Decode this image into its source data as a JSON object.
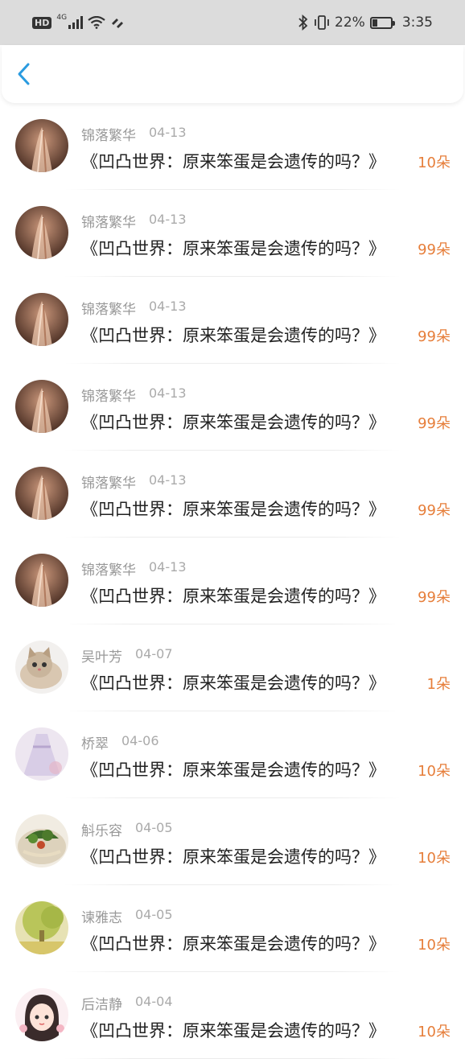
{
  "status_bar": {
    "hd": "HD",
    "network": "4G",
    "battery": "22%",
    "time": "3:35"
  },
  "nav": {
    "back_icon": "chevron-left-icon",
    "accent": "#2a9be0"
  },
  "colors": {
    "count": "#e67e3a",
    "name": "#999999",
    "title": "#222222"
  },
  "items": [
    {
      "name": "锦落繁华",
      "date": "04-13",
      "title": "《凹凸世界：原来笨蛋是会遗传的吗？》",
      "count": "10朵",
      "avatar": "hair-portrait"
    },
    {
      "name": "锦落繁华",
      "date": "04-13",
      "title": "《凹凸世界：原来笨蛋是会遗传的吗？》",
      "count": "99朵",
      "avatar": "hair-portrait"
    },
    {
      "name": "锦落繁华",
      "date": "04-13",
      "title": "《凹凸世界：原来笨蛋是会遗传的吗？》",
      "count": "99朵",
      "avatar": "hair-portrait"
    },
    {
      "name": "锦落繁华",
      "date": "04-13",
      "title": "《凹凸世界：原来笨蛋是会遗传的吗？》",
      "count": "99朵",
      "avatar": "hair-portrait"
    },
    {
      "name": "锦落繁华",
      "date": "04-13",
      "title": "《凹凸世界：原来笨蛋是会遗传的吗？》",
      "count": "99朵",
      "avatar": "hair-portrait"
    },
    {
      "name": "锦落繁华",
      "date": "04-13",
      "title": "《凹凸世界：原来笨蛋是会遗传的吗？》",
      "count": "99朵",
      "avatar": "hair-portrait"
    },
    {
      "name": "吴叶芳",
      "date": "04-07",
      "title": "《凹凸世界：原来笨蛋是会遗传的吗？》",
      "count": "1朵",
      "avatar": "kitten"
    },
    {
      "name": "桥翠",
      "date": "04-06",
      "title": "《凹凸世界：原来笨蛋是会遗传的吗？》",
      "count": "10朵",
      "avatar": "dress"
    },
    {
      "name": "斛乐容",
      "date": "04-05",
      "title": "《凹凸世界：原来笨蛋是会遗传的吗？》",
      "count": "10朵",
      "avatar": "food"
    },
    {
      "name": "谏雅志",
      "date": "04-05",
      "title": "《凹凸世界：原来笨蛋是会遗传的吗？》",
      "count": "10朵",
      "avatar": "tree"
    },
    {
      "name": "后洁静",
      "date": "04-04",
      "title": "《凹凸世界：原来笨蛋是会遗传的吗？》",
      "count": "10朵",
      "avatar": "cartoon-girl"
    }
  ]
}
